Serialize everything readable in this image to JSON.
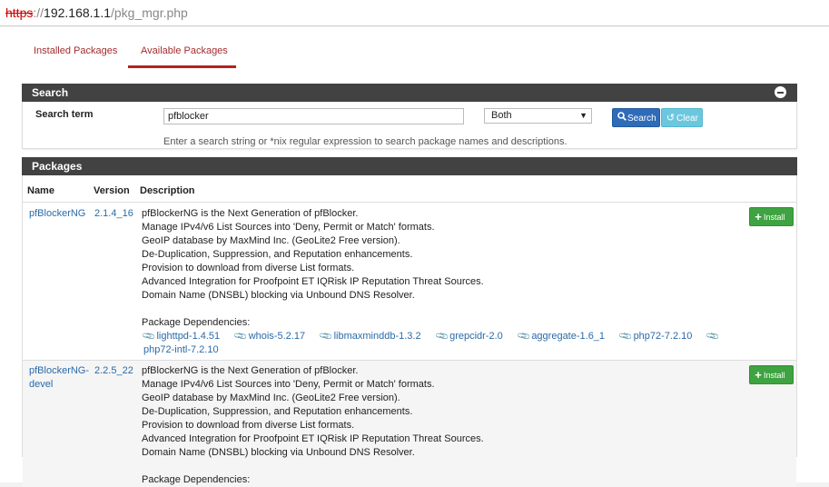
{
  "url": {
    "scheme": "https",
    "sep": "://",
    "host": "192.168.1.1",
    "path": "/pkg_mgr.php"
  },
  "tabs": [
    {
      "label": "Installed Packages",
      "active": false
    },
    {
      "label": "Available Packages",
      "active": true
    }
  ],
  "search": {
    "panel_title": "Search",
    "term_label": "Search term",
    "term_value": "pfblocker",
    "scope_selected": "Both",
    "search_button": "Search",
    "clear_button": "Clear",
    "help_text": "Enter a search string or *nix regular expression to search package names and descriptions."
  },
  "packages": {
    "panel_title": "Packages",
    "columns": [
      "Name",
      "Version",
      "Description"
    ],
    "install_label": "Install",
    "deps_label": "Package Dependencies:",
    "rows": [
      {
        "name": "pfBlockerNG",
        "version": "2.1.4_16",
        "description": [
          "pfBlockerNG is the Next Generation of pfBlocker.",
          "Manage IPv4/v6 List Sources into 'Deny, Permit or Match' formats.",
          "GeoIP database by MaxMind Inc. (GeoLite2 Free version).",
          "De-Duplication, Suppression, and Reputation enhancements.",
          "Provision to download from diverse List formats.",
          "Advanced Integration for Proofpoint ET IQRisk IP Reputation Threat Sources.",
          "Domain Name (DNSBL) blocking via Unbound DNS Resolver."
        ],
        "dependencies": [
          "lighttpd-1.4.51",
          "whois-5.2.17",
          "libmaxminddb-1.3.2",
          "grepcidr-2.0",
          "aggregate-1.6_1",
          "php72-7.2.10",
          "php72-intl-7.2.10"
        ]
      },
      {
        "name": "pfBlockerNG-devel",
        "version": "2.2.5_22",
        "description": [
          "pfBlockerNG is the Next Generation of pfBlocker.",
          "Manage IPv4/v6 List Sources into 'Deny, Permit or Match' formats.",
          "GeoIP database by MaxMind Inc. (GeoLite2 Free version).",
          "De-Duplication, Suppression, and Reputation enhancements.",
          "Provision to download from diverse List formats.",
          "Advanced Integration for Proofpoint ET IQRisk IP Reputation Threat Sources.",
          "Domain Name (DNSBL) blocking via Unbound DNS Resolver."
        ],
        "dependencies": []
      }
    ]
  },
  "colors": {
    "header_bg": "#424242",
    "link": "#2a6aa8",
    "tab_active": "#b22222",
    "install": "#3ea340",
    "search_btn": "#2e6bb8",
    "clear_btn": "#6cc7de"
  }
}
